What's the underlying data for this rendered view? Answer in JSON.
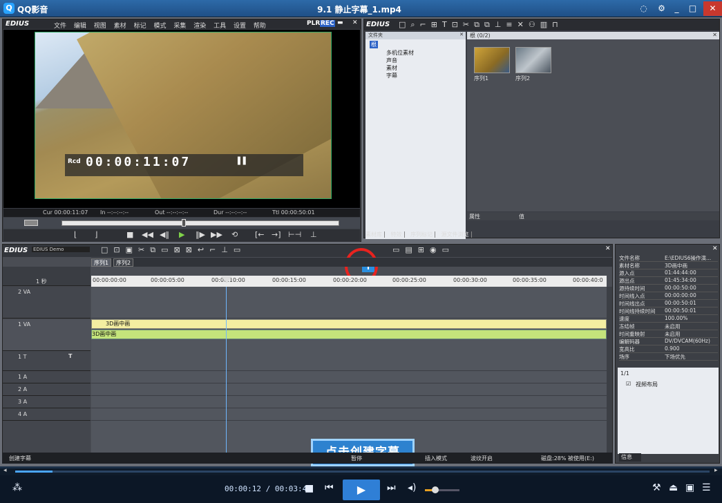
{
  "window": {
    "app_name": "QQ影音",
    "video_title": "9.1 静止字幕_1.mp4"
  },
  "recorder": {
    "logo": "EDIUS",
    "menu": [
      "文件",
      "编辑",
      "视图",
      "素材",
      "标记",
      "模式",
      "采集",
      "渲染",
      "工具",
      "设置",
      "帮助"
    ],
    "mode_plr": "PLR",
    "mode_rec": "REC",
    "tc_label": "Rcd",
    "tc_value": "00:00:11:07",
    "tc_row": {
      "cur": "Cur 00:00:11:07",
      "in": "In --:--:--:--",
      "out": "Out --:--:--:--",
      "dur": "Dur --:--:--:--",
      "ttl": "Ttl 00:00:50:01"
    }
  },
  "bin": {
    "logo": "EDIUS",
    "tree_header": "文件夹",
    "tree_root": "根",
    "tree_items": [
      "多机位素材",
      "声音",
      "素材",
      "字幕"
    ],
    "count": "根 (0/2)",
    "clips": [
      "序列1",
      "序列2"
    ],
    "prop_col1": "属性",
    "prop_col2": "值",
    "tabs": [
      "素材库",
      "特效",
      "序列标记",
      "源文件浏览"
    ]
  },
  "timeline": {
    "logo": "EDIUS",
    "project_name": "EDIUS Demo",
    "zoom": "1 秒",
    "seq_tabs": [
      "序列1",
      "序列2"
    ],
    "ruler": [
      "00:00:00:00",
      "00:00:05:00",
      "00:00:10:00",
      "00:00:15:00",
      "00:00:20:00",
      "00:00:25:00",
      "00:00:30:00",
      "00:00:35:00",
      "00:00:40:0"
    ],
    "tracks": [
      "2 VA",
      "1 VA",
      "1 T",
      "1 A",
      "2 A",
      "3 A",
      "4 A"
    ],
    "clip_video": "3D画中画",
    "clip_audio": "3D画中画",
    "overlay": "点击创建字幕"
  },
  "status": {
    "left": "创建字幕",
    "pause": "暂停",
    "mode": "插入模式",
    "loop": "波纹开启",
    "disk": "磁盘:28% 被使用(E:)"
  },
  "info": {
    "rows": [
      [
        "文件名称",
        "E:\\EDIUS6操作演..."
      ],
      [
        "素材名称",
        "3D画中画"
      ],
      [
        "源入点",
        "01:44:44:00"
      ],
      [
        "源出点",
        "01:45:34:00"
      ],
      [
        "源持续时间",
        "00:00:50:00"
      ],
      [
        "时间线入点",
        "00:00:00:00"
      ],
      [
        "时间线出点",
        "00:00:50:01"
      ],
      [
        "时间线持续时间",
        "00:00:50:01"
      ],
      [
        "速度",
        "100.00%"
      ],
      [
        "冻结帧",
        "未启用"
      ],
      [
        "时间重映射",
        "未启用"
      ],
      [
        "编解码器",
        "DV/DVCAM(60Hz)"
      ],
      [
        "宽高比",
        "0.900"
      ],
      [
        "场序",
        "下场优先"
      ]
    ],
    "layout_count": "1/1",
    "layout_item": "视频布局",
    "tab": "信息"
  },
  "player": {
    "current": "00:00:12",
    "total": "00:03:42",
    "progress": 0.054
  }
}
